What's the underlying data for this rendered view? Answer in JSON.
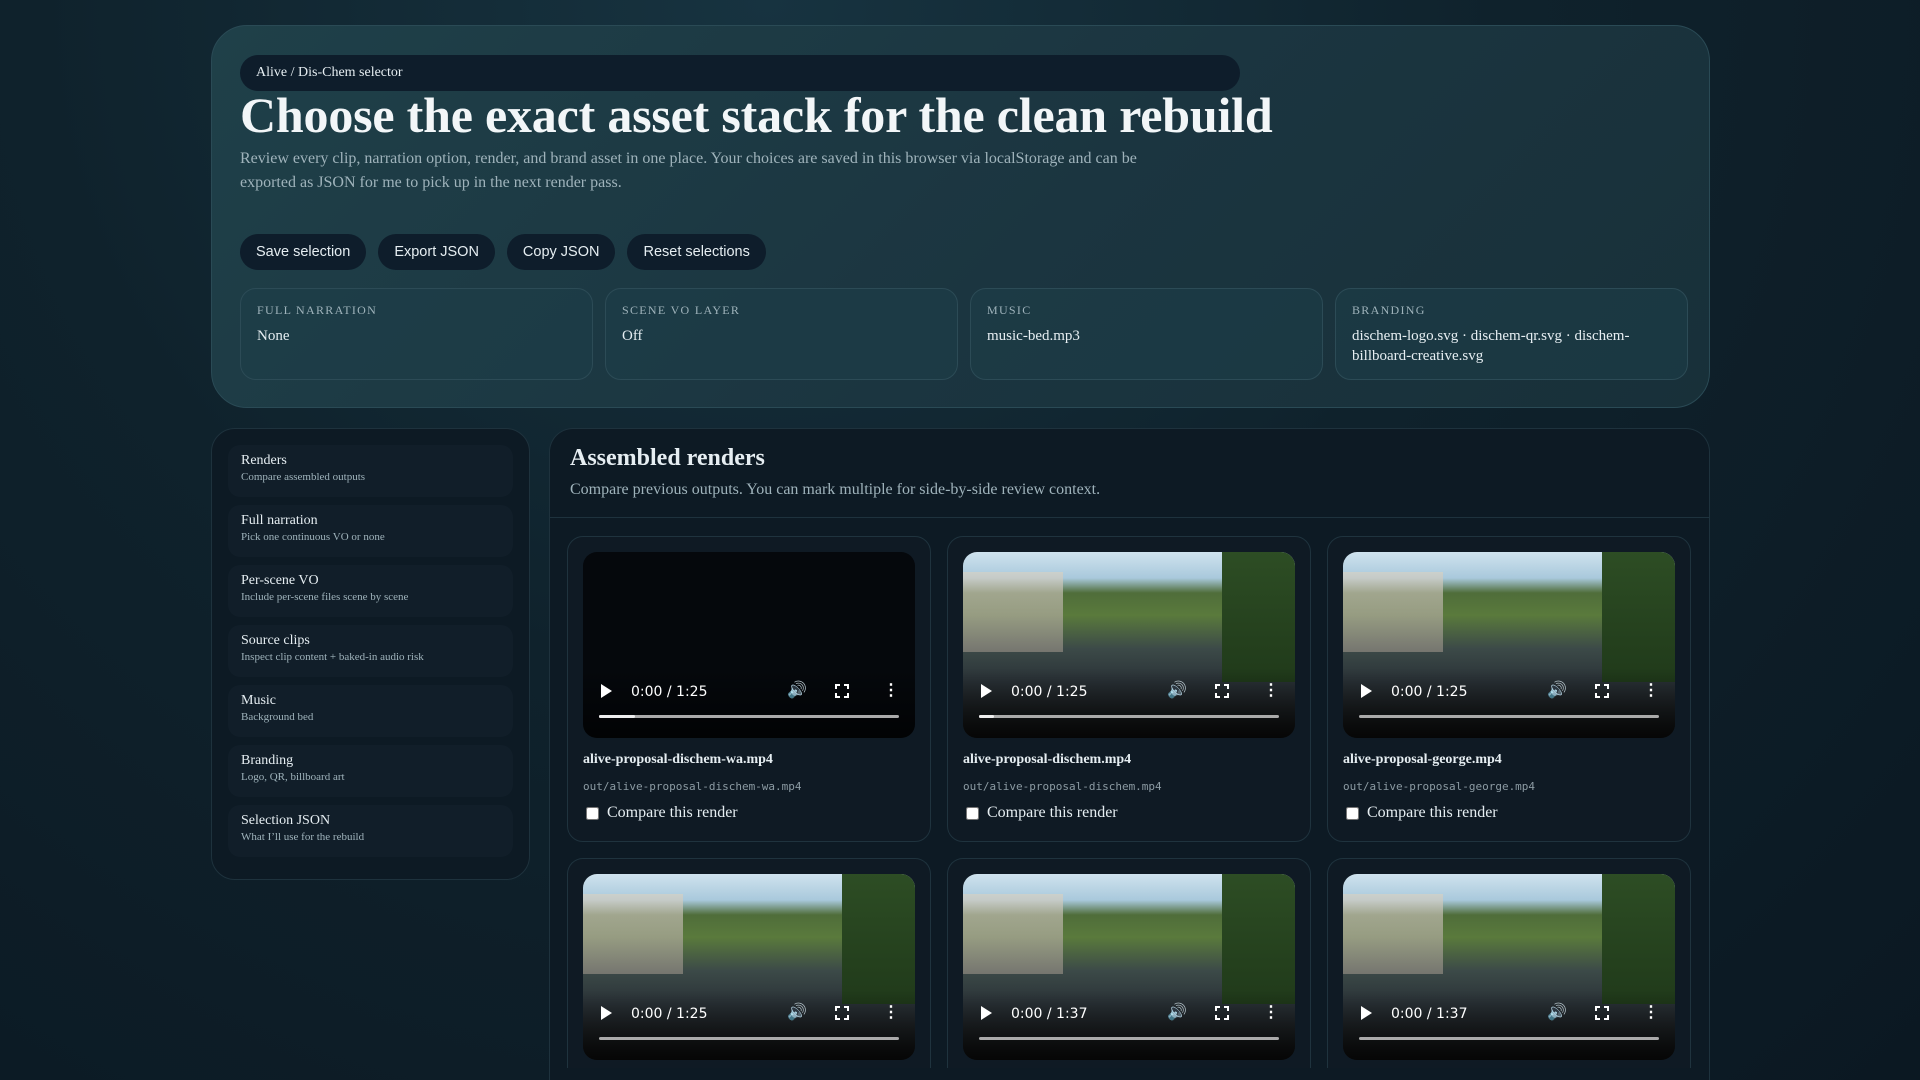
{
  "header": {
    "breadcrumb": "Alive / Dis-Chem selector",
    "title": "Choose the exact asset stack for the clean rebuild",
    "description": "Review every clip, narration option, render, and brand asset in one place. Your choices are saved in this browser via localStorage and can be exported as JSON for me to pick up in the next render pass."
  },
  "actions": [
    {
      "label": "Save selection"
    },
    {
      "label": "Export JSON"
    },
    {
      "label": "Copy JSON"
    },
    {
      "label": "Reset selections"
    }
  ],
  "summary": [
    {
      "label": "Full narration",
      "value": "None"
    },
    {
      "label": "Scene VO layer",
      "value": "Off"
    },
    {
      "label": "Music",
      "value": "music-bed.mp3"
    },
    {
      "label": "Branding",
      "value": "dischem-logo.svg · dischem-qr.svg · dischem-billboard-creative.svg"
    }
  ],
  "sidebar": [
    {
      "title": "Renders",
      "sub": "Compare assembled outputs"
    },
    {
      "title": "Full narration",
      "sub": "Pick one continuous VO or none"
    },
    {
      "title": "Per-scene VO",
      "sub": "Include per-scene files scene by scene"
    },
    {
      "title": "Source clips",
      "sub": "Inspect clip content + baked-in audio risk"
    },
    {
      "title": "Music",
      "sub": "Background bed"
    },
    {
      "title": "Branding",
      "sub": "Logo, QR, billboard art"
    },
    {
      "title": "Selection JSON",
      "sub": "What I’ll use for the rebuild"
    }
  ],
  "renders": {
    "heading": "Assembled renders",
    "subtitle": "Compare previous outputs. You can mark multiple for side-by-side review context.",
    "compare_label": "Compare this render",
    "items": [
      {
        "name": "alive-proposal-dischem-wa.mp4",
        "path": "out/alive-proposal-dischem-wa.mp4",
        "time": "0:00 / 1:25",
        "progress": 0.12,
        "poster": false
      },
      {
        "name": "alive-proposal-dischem.mp4",
        "path": "out/alive-proposal-dischem.mp4",
        "time": "0:00 / 1:25",
        "progress": 0.05,
        "poster": true
      },
      {
        "name": "alive-proposal-george.mp4",
        "path": "out/alive-proposal-george.mp4",
        "time": "0:00 / 1:25",
        "progress": 0.0,
        "poster": true
      },
      {
        "name": "",
        "path": "",
        "time": "0:00 / 1:25",
        "progress": 0.0,
        "poster": true
      },
      {
        "name": "",
        "path": "",
        "time": "0:00 / 1:37",
        "progress": 0.0,
        "poster": true
      },
      {
        "name": "",
        "path": "",
        "time": "0:00 / 1:37",
        "progress": 0.0,
        "poster": true
      }
    ]
  }
}
